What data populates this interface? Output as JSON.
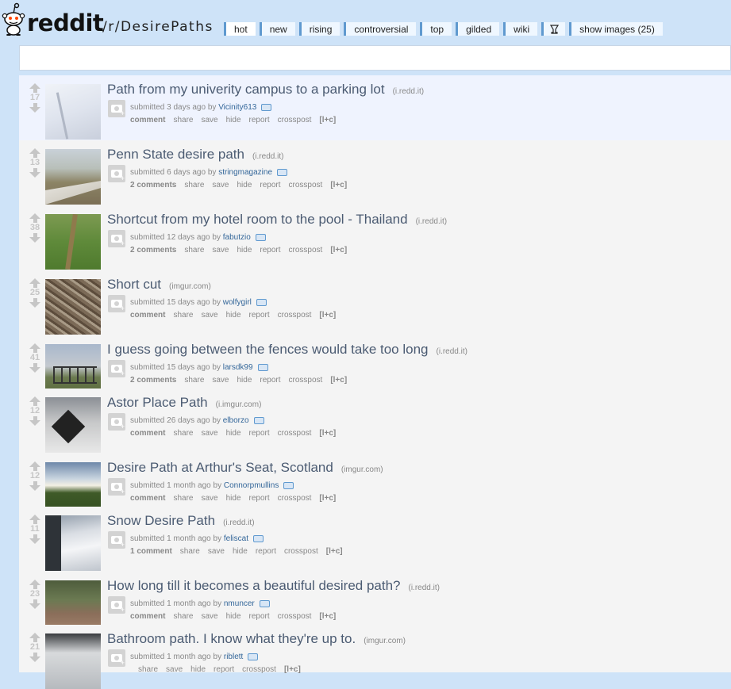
{
  "header": {
    "wordmark": "reddit",
    "subreddit": "/r/DesirePaths",
    "tabs": [
      {
        "label": "hot",
        "selected": true
      },
      {
        "label": "new"
      },
      {
        "label": "rising"
      },
      {
        "label": "controversial"
      },
      {
        "label": "top"
      },
      {
        "label": "gilded"
      },
      {
        "label": "wiki"
      },
      {
        "label": "",
        "icon": "trophy-icon"
      },
      {
        "label": "show images (25)"
      }
    ]
  },
  "colors": {
    "header_bg": "#cee3f8",
    "title": "#4b5b72",
    "author": "#336699",
    "muted": "#888888"
  },
  "posts": [
    {
      "score": "17",
      "title": "Path from my univerity campus to a parking lot",
      "domain": "(i.redd.it)",
      "submitted": "submitted 3 days ago by",
      "author": "Vicinity613",
      "comments": "comment",
      "thumb": "snow"
    },
    {
      "score": "13",
      "title": "Penn State desire path",
      "domain": "(i.redd.it)",
      "submitted": "submitted 6 days ago by",
      "author": "stringmagazine",
      "comments": "2 comments",
      "thumb": "penn"
    },
    {
      "score": "38",
      "title": "Shortcut from my hotel room to the pool - Thailand",
      "domain": "(i.redd.it)",
      "submitted": "submitted 12 days ago by",
      "author": "fabutzio",
      "comments": "2 comments",
      "thumb": "grass"
    },
    {
      "score": "25",
      "title": "Short cut",
      "domain": "(imgur.com)",
      "submitted": "submitted 15 days ago by",
      "author": "wolfygirl",
      "comments": "comment",
      "thumb": "roots"
    },
    {
      "score": "41",
      "title": "I guess going between the fences would take too long",
      "domain": "(i.redd.it)",
      "submitted": "submitted 15 days ago by",
      "author": "larsdk99",
      "comments": "2 comments",
      "thumb": "fence"
    },
    {
      "score": "12",
      "title": "Astor Place Path",
      "domain": "(i.imgur.com)",
      "submitted": "submitted 26 days ago by",
      "author": "elborzo",
      "comments": "comment",
      "thumb": "astor"
    },
    {
      "score": "12",
      "title": "Desire Path at Arthur's Seat, Scotland",
      "domain": "(imgur.com)",
      "submitted": "submitted 1 month ago by",
      "author": "Connorpmullins",
      "comments": "comment",
      "thumb": "arthur"
    },
    {
      "score": "11",
      "title": "Snow Desire Path",
      "domain": "(i.redd.it)",
      "submitted": "submitted 1 month ago by",
      "author": "feliscat",
      "comments": "1 comment",
      "thumb": "snow2"
    },
    {
      "score": "23",
      "title": "How long till it becomes a beautiful desired path?",
      "domain": "(i.redd.it)",
      "submitted": "submitted 1 month ago by",
      "author": "nmuncer",
      "comments": "comment",
      "thumb": "brick"
    },
    {
      "score": "21",
      "title": "Bathroom path. I know what they're up to.",
      "domain": "(imgur.com)",
      "submitted": "submitted 1 month ago by",
      "author": "riblett",
      "comments": "",
      "thumb": "bath"
    }
  ],
  "actions": {
    "share": "share",
    "save": "save",
    "hide": "hide",
    "report": "report",
    "crosspost": "crosspost",
    "rank": "[l+c]"
  }
}
